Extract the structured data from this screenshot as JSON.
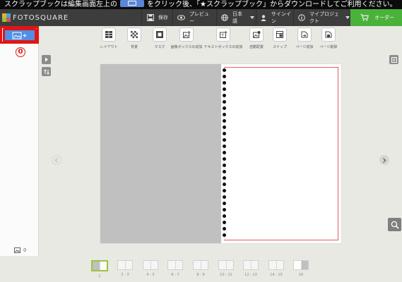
{
  "banner": {
    "before": "スクラップブックは編集画面左上の",
    "after": "をクリック後、「★スクラップブック」からダウンロードしてご利用ください。"
  },
  "nav": {
    "logo_text": "FOTOSQUARE",
    "save": "保存",
    "preview": "プレビュー",
    "language": "日本語",
    "signin": "サインイン",
    "my_project": "マイプロジェクト",
    "order": "オーダー"
  },
  "toolbar": {
    "tools": [
      "レイアウト",
      "背景",
      "マスク",
      "画像ボックスの追加",
      "テキストボックスの追加",
      "自動配置",
      "スナップ",
      "ページ追加",
      "ページ削除"
    ]
  },
  "sidebar": {
    "callout": "0",
    "photo_count": "0"
  },
  "pager": {
    "pages": [
      "1",
      "2 - 3",
      "4 - 5",
      "6 - 7",
      "8 - 9",
      "10 - 11",
      "12 - 13",
      "14 - 15",
      "16"
    ]
  },
  "colors": {
    "accent_blue": "#4f8fe8",
    "order_green": "#4ab23a",
    "highlight_red": "#e01616"
  }
}
